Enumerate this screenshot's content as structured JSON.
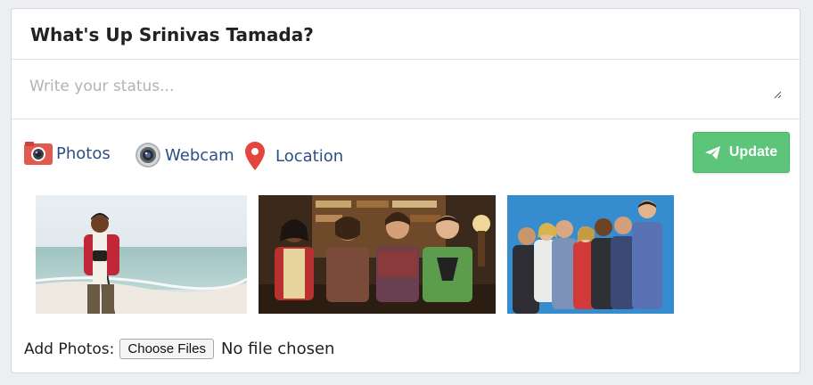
{
  "card": {
    "title": "What's Up Srinivas Tamada?"
  },
  "status": {
    "placeholder": "Write your status..."
  },
  "actions": [
    {
      "label": "Photos",
      "icon": "camera-icon",
      "color": "#e05a4f"
    },
    {
      "label": "Webcam",
      "icon": "webcam-icon",
      "color": "#8a9096"
    },
    {
      "label": "Location",
      "icon": "map-pin-icon",
      "color": "#e2463c"
    }
  ],
  "update_button": {
    "label": "Update",
    "icon": "paper-plane-icon",
    "color": "#5cc57a"
  },
  "photos": [
    {
      "subject": "man with camera on beach"
    },
    {
      "subject": "four men in a living room"
    },
    {
      "subject": "group of people against blue background"
    }
  ],
  "upload": {
    "label": "Add Photos:",
    "button_label": "Choose Files",
    "status_text": "No file chosen"
  }
}
